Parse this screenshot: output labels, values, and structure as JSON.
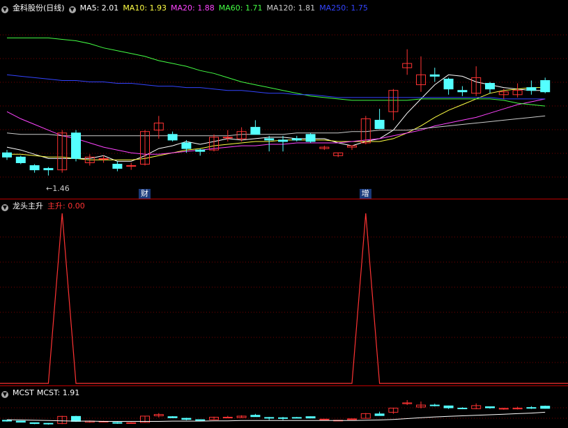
{
  "main_panel": {
    "stock_name": "金科股份(日线)",
    "ma_indicators": [
      {
        "label": "MA5: 2.01",
        "color": "#ffffff"
      },
      {
        "label": "MA10: 1.93",
        "color": "#ffff44"
      },
      {
        "label": "MA20: 1.88",
        "color": "#ff44ff"
      },
      {
        "label": "MA60: 1.71",
        "color": "#44ff44"
      },
      {
        "label": "MA120: 1.81",
        "color": "#cccccc"
      },
      {
        "label": "MA250: 1.75",
        "color": "#3344ff"
      }
    ],
    "low_marker": "←1.46",
    "event_labels": [
      "财",
      "增"
    ]
  },
  "indicator_panel": {
    "name": "龙头主升",
    "value_label": "主升: 0.00"
  },
  "mcst_panel": {
    "name": "MCST",
    "value_label": "MCST: 1.91"
  },
  "colors": {
    "up": "#ff3333",
    "down": "#54ffff",
    "grid": "#7a0000",
    "border": "#c00000",
    "event_bg": "#1a3a7a"
  },
  "chart_data": {
    "type": "candlestick",
    "candles": [
      {
        "o": 1.62,
        "h": 1.64,
        "l": 1.57,
        "c": 1.59
      },
      {
        "o": 1.59,
        "h": 1.6,
        "l": 1.54,
        "c": 1.55
      },
      {
        "o": 1.53,
        "h": 1.54,
        "l": 1.48,
        "c": 1.5
      },
      {
        "o": 1.51,
        "h": 1.52,
        "l": 1.46,
        "c": 1.5
      },
      {
        "o": 1.5,
        "h": 1.78,
        "l": 1.48,
        "c": 1.76
      },
      {
        "o": 1.76,
        "h": 1.78,
        "l": 1.56,
        "c": 1.58
      },
      {
        "o": 1.55,
        "h": 1.61,
        "l": 1.53,
        "c": 1.59
      },
      {
        "o": 1.58,
        "h": 1.6,
        "l": 1.55,
        "c": 1.58
      },
      {
        "o": 1.54,
        "h": 1.56,
        "l": 1.49,
        "c": 1.51
      },
      {
        "o": 1.53,
        "h": 1.55,
        "l": 1.5,
        "c": 1.53
      },
      {
        "o": 1.54,
        "h": 1.78,
        "l": 1.53,
        "c": 1.77
      },
      {
        "o": 1.78,
        "h": 1.88,
        "l": 1.72,
        "c": 1.83
      },
      {
        "o": 1.75,
        "h": 1.77,
        "l": 1.7,
        "c": 1.71
      },
      {
        "o": 1.69,
        "h": 1.71,
        "l": 1.62,
        "c": 1.65
      },
      {
        "o": 1.64,
        "h": 1.65,
        "l": 1.6,
        "c": 1.63
      },
      {
        "o": 1.64,
        "h": 1.75,
        "l": 1.63,
        "c": 1.73
      },
      {
        "o": 1.73,
        "h": 1.78,
        "l": 1.7,
        "c": 1.73
      },
      {
        "o": 1.72,
        "h": 1.8,
        "l": 1.7,
        "c": 1.77
      },
      {
        "o": 1.8,
        "h": 1.85,
        "l": 1.76,
        "c": 1.75
      },
      {
        "o": 1.72,
        "h": 1.74,
        "l": 1.63,
        "c": 1.71
      },
      {
        "o": 1.71,
        "h": 1.74,
        "l": 1.63,
        "c": 1.7
      },
      {
        "o": 1.72,
        "h": 1.74,
        "l": 1.7,
        "c": 1.71
      },
      {
        "o": 1.75,
        "h": 1.76,
        "l": 1.69,
        "c": 1.7
      },
      {
        "o": 1.65,
        "h": 1.67,
        "l": 1.64,
        "c": 1.66
      },
      {
        "o": 1.6,
        "h": 1.62,
        "l": 1.59,
        "c": 1.62
      },
      {
        "o": 1.66,
        "h": 1.67,
        "l": 1.64,
        "c": 1.67
      },
      {
        "o": 1.69,
        "h": 1.88,
        "l": 1.68,
        "c": 1.86
      },
      {
        "o": 1.85,
        "h": 1.93,
        "l": 1.8,
        "c": 1.79
      },
      {
        "o": 1.91,
        "h": 2.07,
        "l": 1.85,
        "c": 2.06
      },
      {
        "o": 2.22,
        "h": 2.35,
        "l": 2.17,
        "c": 2.25
      },
      {
        "o": 2.1,
        "h": 2.3,
        "l": 2.05,
        "c": 2.17
      },
      {
        "o": 2.17,
        "h": 2.22,
        "l": 2.12,
        "c": 2.16
      },
      {
        "o": 2.14,
        "h": 2.15,
        "l": 2.03,
        "c": 2.07
      },
      {
        "o": 2.06,
        "h": 2.09,
        "l": 2.02,
        "c": 2.05
      },
      {
        "o": 2.04,
        "h": 2.23,
        "l": 2.02,
        "c": 2.15
      },
      {
        "o": 2.11,
        "h": 2.12,
        "l": 2.04,
        "c": 2.07
      },
      {
        "o": 2.03,
        "h": 2.07,
        "l": 2.0,
        "c": 2.05
      },
      {
        "o": 2.03,
        "h": 2.11,
        "l": 2.01,
        "c": 2.06
      },
      {
        "o": 2.08,
        "h": 2.13,
        "l": 2.03,
        "c": 2.06
      },
      {
        "o": 2.13,
        "h": 2.15,
        "l": 2.04,
        "c": 2.05
      }
    ],
    "ma_lines": [
      {
        "name": "MA5",
        "color": "#ffffff",
        "values": [
          1.66,
          1.64,
          1.61,
          1.58,
          1.58,
          1.58,
          1.58,
          1.6,
          1.56,
          1.56,
          1.6,
          1.65,
          1.67,
          1.7,
          1.68,
          1.7,
          1.72,
          1.71,
          1.72,
          1.73,
          1.73,
          1.72,
          1.72,
          1.72,
          1.69,
          1.67,
          1.7,
          1.72,
          1.78,
          1.9,
          2.0,
          2.1,
          2.17,
          2.16,
          2.12,
          2.1,
          2.08,
          2.07,
          2.06,
          2.06
        ]
      },
      {
        "name": "MA10",
        "color": "#ffff44",
        "values": [
          1.61,
          1.61,
          1.6,
          1.59,
          1.59,
          1.58,
          1.57,
          1.57,
          1.57,
          1.57,
          1.58,
          1.6,
          1.62,
          1.64,
          1.65,
          1.67,
          1.68,
          1.69,
          1.7,
          1.7,
          1.71,
          1.71,
          1.71,
          1.71,
          1.7,
          1.7,
          1.7,
          1.7,
          1.72,
          1.76,
          1.81,
          1.87,
          1.92,
          1.96,
          2.0,
          2.04,
          2.06,
          2.07,
          2.08,
          2.08
        ]
      },
      {
        "name": "MA20",
        "color": "#ff44ff",
        "values": [
          1.91,
          1.86,
          1.82,
          1.78,
          1.74,
          1.72,
          1.69,
          1.66,
          1.64,
          1.62,
          1.61,
          1.61,
          1.62,
          1.63,
          1.64,
          1.65,
          1.66,
          1.67,
          1.67,
          1.68,
          1.68,
          1.69,
          1.69,
          1.69,
          1.69,
          1.7,
          1.71,
          1.72,
          1.74,
          1.76,
          1.78,
          1.81,
          1.83,
          1.85,
          1.87,
          1.9,
          1.93,
          1.96,
          1.98,
          2.0
        ]
      },
      {
        "name": "MA60",
        "color": "#44ff44",
        "values": [
          2.43,
          2.43,
          2.43,
          2.43,
          2.42,
          2.41,
          2.39,
          2.36,
          2.34,
          2.32,
          2.3,
          2.27,
          2.25,
          2.23,
          2.2,
          2.18,
          2.15,
          2.12,
          2.1,
          2.08,
          2.06,
          2.04,
          2.02,
          2.01,
          2.0,
          1.99,
          1.99,
          1.99,
          1.99,
          1.99,
          2.0,
          2.0,
          2.0,
          2.0,
          2.0,
          2.0,
          1.99,
          1.97,
          1.96,
          1.95
        ]
      },
      {
        "name": "MA120",
        "color": "#cccccc",
        "values": [
          1.76,
          1.75,
          1.75,
          1.75,
          1.74,
          1.74,
          1.74,
          1.74,
          1.74,
          1.74,
          1.74,
          1.74,
          1.74,
          1.74,
          1.74,
          1.74,
          1.74,
          1.75,
          1.75,
          1.75,
          1.75,
          1.76,
          1.76,
          1.76,
          1.76,
          1.77,
          1.77,
          1.78,
          1.78,
          1.78,
          1.79,
          1.8,
          1.81,
          1.82,
          1.83,
          1.84,
          1.85,
          1.86,
          1.87,
          1.88
        ]
      },
      {
        "name": "MA250",
        "color": "#3344ff",
        "values": [
          2.17,
          2.16,
          2.15,
          2.14,
          2.13,
          2.13,
          2.12,
          2.12,
          2.11,
          2.11,
          2.1,
          2.09,
          2.09,
          2.08,
          2.08,
          2.07,
          2.06,
          2.06,
          2.05,
          2.04,
          2.04,
          2.03,
          2.03,
          2.02,
          2.01,
          2.01,
          2.01,
          2.01,
          2.01,
          2.01,
          2.01,
          2.01,
          2.01,
          2.01,
          2.01,
          2.01,
          2.0,
          2.0,
          2.0,
          2.0
        ]
      }
    ],
    "price_range": [
      1.4,
      2.55
    ],
    "signal_values": [
      0,
      0,
      0,
      0,
      1,
      0,
      0,
      0,
      0,
      0,
      0,
      0,
      0,
      0,
      0,
      0,
      0,
      0,
      0,
      0,
      0,
      0,
      0,
      0,
      0,
      0,
      1,
      0,
      0,
      0,
      0,
      0,
      0,
      0,
      0,
      0,
      0,
      0,
      0,
      0
    ],
    "event_indices": [
      10,
      26
    ],
    "mcst_values": [
      1.64,
      1.63,
      1.62,
      1.61,
      1.6,
      1.59,
      1.59,
      1.58,
      1.58,
      1.58,
      1.58,
      1.58,
      1.59,
      1.59,
      1.59,
      1.6,
      1.6,
      1.61,
      1.61,
      1.61,
      1.61,
      1.61,
      1.61,
      1.61,
      1.61,
      1.61,
      1.62,
      1.63,
      1.65,
      1.68,
      1.71,
      1.74,
      1.76,
      1.78,
      1.8,
      1.82,
      1.84,
      1.86,
      1.88,
      1.91
    ]
  }
}
